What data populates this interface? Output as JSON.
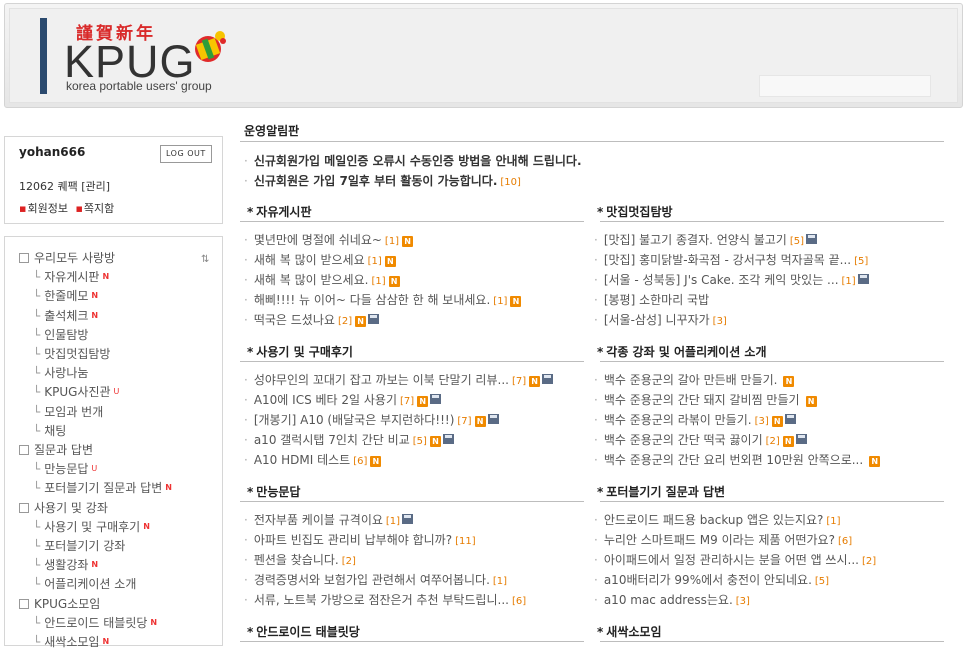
{
  "header": {
    "hanja": "謹賀新年",
    "logo": "KPUG",
    "subtitle": "korea portable users' group"
  },
  "user": {
    "name": "yohan666",
    "logout_label": "LOG OUT",
    "points": "12062 퀘팩 [관리]",
    "link_info": "회원정보",
    "link_note": "쪽지함"
  },
  "menu": [
    {
      "label": "우리모두 사랑방",
      "level": 0,
      "badge": ""
    },
    {
      "label": "자유게시판",
      "level": 1,
      "badge": "N"
    },
    {
      "label": "한줄메모",
      "level": 1,
      "badge": "N"
    },
    {
      "label": "출석체크",
      "level": 1,
      "badge": "N"
    },
    {
      "label": "인물탐방",
      "level": 1,
      "badge": ""
    },
    {
      "label": "맛집멋집탐방",
      "level": 1,
      "badge": ""
    },
    {
      "label": "사랑나눔",
      "level": 1,
      "badge": ""
    },
    {
      "label": "KPUG사진관",
      "level": 1,
      "badge": "U"
    },
    {
      "label": "모임과 번개",
      "level": 1,
      "badge": ""
    },
    {
      "label": "채팅",
      "level": 1,
      "badge": ""
    },
    {
      "label": "질문과 답변",
      "level": 0,
      "badge": ""
    },
    {
      "label": "만능문답",
      "level": 1,
      "badge": "U"
    },
    {
      "label": "포터블기기 질문과 답변",
      "level": 1,
      "badge": "N"
    },
    {
      "label": "사용기 및 강좌",
      "level": 0,
      "badge": ""
    },
    {
      "label": "사용기 및 구매후기",
      "level": 1,
      "badge": "N"
    },
    {
      "label": "포터블기기 강좌",
      "level": 1,
      "badge": ""
    },
    {
      "label": "생활강좌",
      "level": 1,
      "badge": "N"
    },
    {
      "label": "어플리케이션 소개",
      "level": 1,
      "badge": ""
    },
    {
      "label": "KPUG소모임",
      "level": 0,
      "badge": ""
    },
    {
      "label": "안드로이드 태블릿당",
      "level": 1,
      "badge": "N"
    },
    {
      "label": "새싹소모임",
      "level": 1,
      "badge": "N"
    }
  ],
  "notice": {
    "title": "운영알림판",
    "items": [
      {
        "text": "신규회원가입 메일인증 오류시 수동인증 방법을 안내해 드립니다.",
        "count": ""
      },
      {
        "text": "신규회원은 가입 7일후 부터 활동이 가능합니다.",
        "count": "[10]"
      }
    ]
  },
  "sections": [
    {
      "title": "자유게시판",
      "posts": [
        {
          "text": "몇년만에 명절에 쉬네요~",
          "count": "[1]",
          "n": true,
          "f": false
        },
        {
          "text": "새해 복 많이 받으세요",
          "count": "[1]",
          "n": true,
          "f": false
        },
        {
          "text": "새해 복 많이 받으세요.",
          "count": "[1]",
          "n": true,
          "f": false
        },
        {
          "text": "해삐!!!! 뉴 이어~ 다들 삼삼한 한 해 보내세요.",
          "count": "[1]",
          "n": true,
          "f": false
        },
        {
          "text": "떡국은 드셨나요",
          "count": "[2]",
          "n": true,
          "f": true
        }
      ]
    },
    {
      "title": "맛집멋집탐방",
      "posts": [
        {
          "text": "[맛집] 불고기 종결자. 언양식 불고기",
          "count": "[5]",
          "n": false,
          "f": true
        },
        {
          "text": "[맛집] 홍미닭발-화곡점 - 강서구청 먹자골목 끝...",
          "count": "[5]",
          "n": false,
          "f": false
        },
        {
          "text": "[서울 - 성북동] J's Cake. 조각 케익 맛있는 ...",
          "count": "[1]",
          "n": false,
          "f": true
        },
        {
          "text": "[봉평] 소한마리 국밥",
          "count": "",
          "n": false,
          "f": false
        },
        {
          "text": "[서울-삼성] 니꾸자가",
          "count": "[3]",
          "n": false,
          "f": false
        }
      ]
    },
    {
      "title": "사용기 및 구매후기",
      "posts": [
        {
          "text": "성야무인의 꼬대기 잡고 까보는 이북 단말기 리뷰...",
          "count": "[7]",
          "n": true,
          "f": true
        },
        {
          "text": "A10에 ICS 베타 2일 사용기",
          "count": "[7]",
          "n": true,
          "f": true
        },
        {
          "text": "[개봉기] A10 (배달국은 부지런하다!!!)",
          "count": "[7]",
          "n": true,
          "f": true
        },
        {
          "text": "a10 갤럭시탭 7인치 간단 비교",
          "count": "[5]",
          "n": true,
          "f": true
        },
        {
          "text": "A10 HDMI 테스트",
          "count": "[6]",
          "n": true,
          "f": false
        }
      ]
    },
    {
      "title": "각종 강좌 및 어플리케이션 소개",
      "posts": [
        {
          "text": "백수 준용군의 갈아 만든배 만들기.",
          "count": "",
          "n": true,
          "f": false
        },
        {
          "text": "백수 준용군의 간단 돼지 갈비찜 만들기",
          "count": "",
          "n": true,
          "f": false
        },
        {
          "text": "백수 준용군의 라볶이 만들기.",
          "count": "[3]",
          "n": true,
          "f": true
        },
        {
          "text": "백수 준용군의 간단 떡국 끓이기",
          "count": "[2]",
          "n": true,
          "f": true
        },
        {
          "text": "백수 준용군의 간단 요리 번외편 10만원 안쪽으로...",
          "count": "",
          "n": true,
          "f": false
        }
      ]
    },
    {
      "title": "만능문답",
      "posts": [
        {
          "text": "전자부품 케이블 규격이요",
          "count": "[1]",
          "n": false,
          "f": true
        },
        {
          "text": "아파트 빈집도 관리비 납부해야 합니까?",
          "count": "[11]",
          "n": false,
          "f": false
        },
        {
          "text": "펜션을 찾습니다.",
          "count": "[2]",
          "n": false,
          "f": false
        },
        {
          "text": "경력증명서와 보험가입 관련해서 여쭈어봅니다.",
          "count": "[1]",
          "n": false,
          "f": false
        },
        {
          "text": "서류, 노트북 가방으로 점잔은거 추천 부탁드립니...",
          "count": "[6]",
          "n": false,
          "f": false
        }
      ]
    },
    {
      "title": "포터블기기 질문과 답변",
      "posts": [
        {
          "text": "안드로이드 패드용 backup 앱은 있는지요?",
          "count": "[1]",
          "n": false,
          "f": false
        },
        {
          "text": "누리안 스마트패드 M9 이라는 제품 어떤가요?",
          "count": "[6]",
          "n": false,
          "f": false
        },
        {
          "text": "아이패드에서 일정 관리하시는 분을 어떤 앱 쓰시...",
          "count": "[2]",
          "n": false,
          "f": false
        },
        {
          "text": "a10배터리가 99%에서 충전이 안되네요.",
          "count": "[5]",
          "n": false,
          "f": false
        },
        {
          "text": "a10 mac address는요.",
          "count": "[3]",
          "n": false,
          "f": false
        }
      ]
    },
    {
      "title": "안드로이드 태블릿당",
      "posts": []
    },
    {
      "title": "새싹소모임",
      "posts": []
    }
  ]
}
